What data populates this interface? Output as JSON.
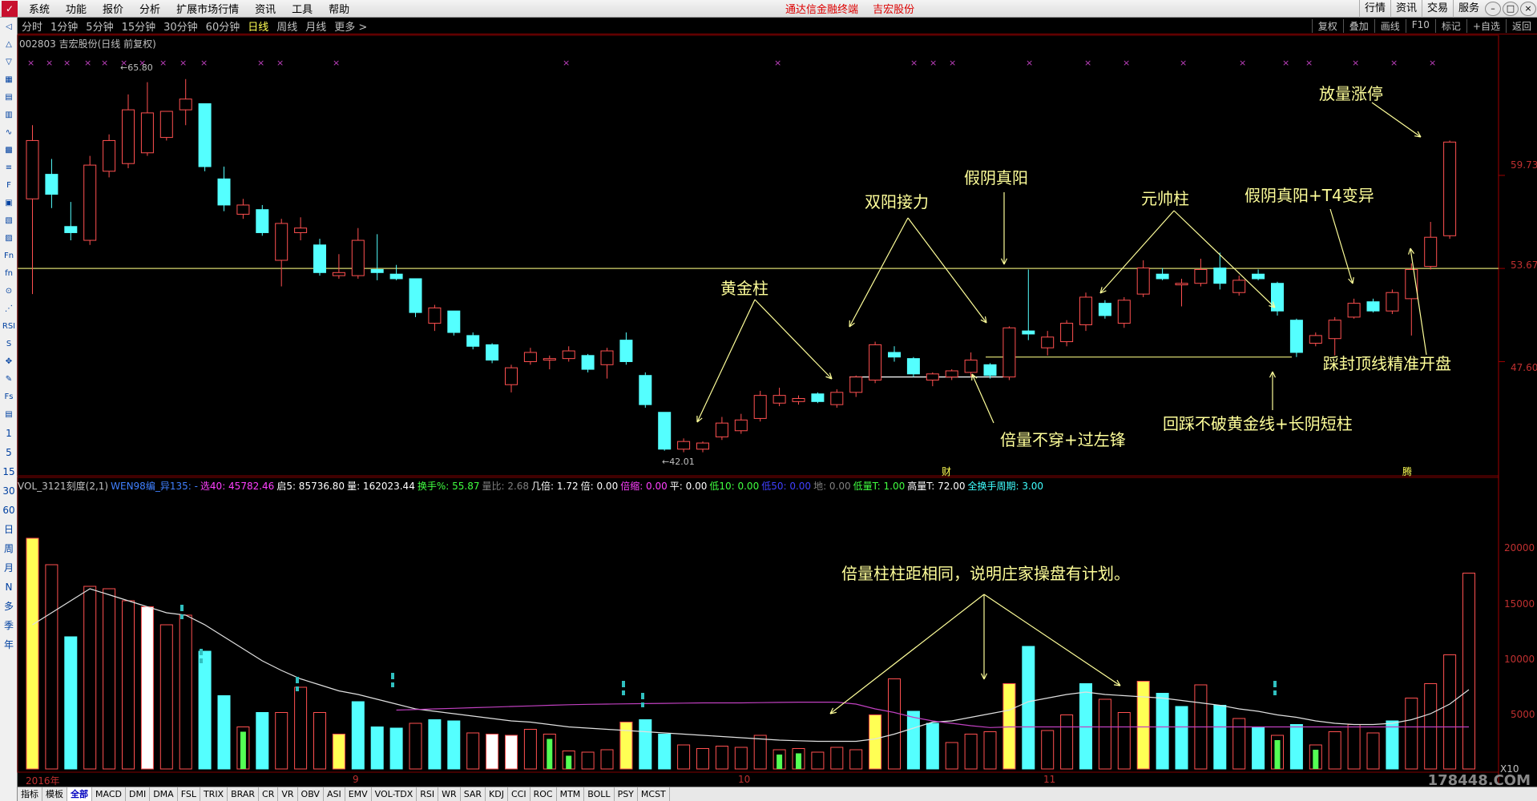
{
  "menubar": {
    "items": [
      "系统",
      "功能",
      "报价",
      "分析",
      "扩展市场行情",
      "资讯",
      "工具",
      "帮助"
    ],
    "center_title": [
      "通达信金融终端",
      "吉宏股份"
    ],
    "right_buttons": [
      "行情",
      "资讯",
      "交易",
      "服务"
    ]
  },
  "periodbar": {
    "items": [
      "分时",
      "1分钟",
      "5分钟",
      "15分钟",
      "30分钟",
      "60分钟",
      "日线",
      "周线",
      "月线",
      "更多 >"
    ],
    "active": "日线",
    "right_buttons": [
      "复权",
      "叠加",
      "画线",
      "F10",
      "标记",
      "+自选",
      "返回"
    ]
  },
  "stock": {
    "title": "002803 吉宏股份(日线 前复权)"
  },
  "toolstrip": {
    "tools": [
      "◁",
      "△",
      "▽",
      "▦",
      "▤",
      "▥",
      "∿",
      "▩",
      "≡",
      "F",
      "▣",
      "▧",
      "▨",
      "Fn",
      "fn",
      "⊙",
      "⋰",
      "RSI",
      "S",
      "✥",
      "✎",
      "Fs",
      "▤"
    ],
    "periods": [
      "1",
      "5",
      "15",
      "30",
      "60",
      "日",
      "周",
      "月",
      "N",
      "多",
      "季",
      "年"
    ]
  },
  "price_axis": {
    "labels": [
      "59.73",
      "53.67",
      "47.60"
    ]
  },
  "volume_axis": {
    "labels": [
      "20000",
      "15000",
      "10000",
      "5000"
    ],
    "unit": "X10"
  },
  "x_axis": {
    "labels": [
      "2016年",
      "9",
      "10",
      "11"
    ]
  },
  "markers": {
    "high_label": "65.80",
    "low_label": "42.01",
    "cai": "财",
    "teng": "腾"
  },
  "indicator_line": [
    {
      "text": "VOL_3121刻度(2,1)",
      "color": "#c0c0c0"
    },
    {
      "text": "WEN98编_异135: -",
      "color": "#4080ff"
    },
    {
      "text": "选40: 45782.46",
      "color": "#ff40ff"
    },
    {
      "text": "启5: 85736.80",
      "color": "#ffffff"
    },
    {
      "text": "量: 162023.44",
      "color": "#ffffff"
    },
    {
      "text": "换手%: 55.87",
      "color": "#40ff40"
    },
    {
      "text": "量比: 2.68",
      "color": "#808080"
    },
    {
      "text": "几倍: 1.72",
      "color": "#ffffff"
    },
    {
      "text": "倍: 0.00",
      "color": "#ffffff"
    },
    {
      "text": "倍缩: 0.00",
      "color": "#ff40ff"
    },
    {
      "text": "平: 0.00",
      "color": "#ffffff"
    },
    {
      "text": "低10: 0.00",
      "color": "#40ff40"
    },
    {
      "text": "低50: 0.00",
      "color": "#4040ff"
    },
    {
      "text": "地: 0.00",
      "color": "#808080"
    },
    {
      "text": "低量T: 1.00",
      "color": "#40ff40"
    },
    {
      "text": "高量T: 72.00",
      "color": "#ffffff"
    },
    {
      "text": "全换手周期: 3.00",
      "color": "#40ffff"
    }
  ],
  "annotations": {
    "golden_pillar": "黄金柱",
    "double_yang": "双阳接力",
    "fake_yin": "假阴真阳",
    "marshal": "元帅柱",
    "fake_yin_t4": "假阴真阳+T4变异",
    "volume_limit_up": "放量涨停",
    "step_top_line": "踩封顶线精准开盘",
    "double_volume": "倍量不穿+过左锋",
    "return_step": "回踩不破黄金线+长阴短柱",
    "volume_spacing": "倍量柱柱距相同，说明庄家操盘有计划。"
  },
  "tabbar": {
    "tabs": [
      "指标",
      "模板",
      "全部",
      "MACD",
      "DMI",
      "DMA",
      "FSL",
      "TRIX",
      "BRAR",
      "CR",
      "VR",
      "OBV",
      "ASI",
      "EMV",
      "VOL-TDX",
      "RSI",
      "WR",
      "SAR",
      "KDJ",
      "CCI",
      "ROC",
      "MTM",
      "BOLL",
      "PSY",
      "MCST"
    ],
    "active": "全部"
  },
  "watermark": "178448.COM",
  "chart_data": {
    "type": "candlestick",
    "price_range": [
      41.0,
      67.5
    ],
    "candles": [
      {
        "o": 58.2,
        "c": 62.0,
        "h": 63.0,
        "l": 52.0
      },
      {
        "o": 59.8,
        "c": 58.5,
        "h": 60.8,
        "l": 57.6
      },
      {
        "o": 56.4,
        "c": 56.0,
        "h": 58.0,
        "l": 55.5
      },
      {
        "o": 55.5,
        "c": 60.4,
        "h": 61.0,
        "l": 55.2
      },
      {
        "o": 60.0,
        "c": 62.0,
        "h": 62.4,
        "l": 59.6
      },
      {
        "o": 60.5,
        "c": 64.0,
        "h": 65.0,
        "l": 60.2
      },
      {
        "o": 61.2,
        "c": 63.8,
        "h": 65.8,
        "l": 61.0
      },
      {
        "o": 62.2,
        "c": 63.9,
        "h": 63.9,
        "l": 62.0
      },
      {
        "o": 64.0,
        "c": 64.7,
        "h": 66.0,
        "l": 63.0
      },
      {
        "o": 64.4,
        "c": 60.3,
        "h": 64.4,
        "l": 60.0
      },
      {
        "o": 59.5,
        "c": 57.8,
        "h": 60.3,
        "l": 57.4
      },
      {
        "o": 57.2,
        "c": 57.8,
        "h": 58.2,
        "l": 56.9
      },
      {
        "o": 57.5,
        "c": 56.0,
        "h": 57.8,
        "l": 55.8
      },
      {
        "o": 54.2,
        "c": 56.6,
        "h": 56.9,
        "l": 52.5
      },
      {
        "o": 56.0,
        "c": 56.3,
        "h": 57.0,
        "l": 55.5
      },
      {
        "o": 55.2,
        "c": 53.4,
        "h": 55.6,
        "l": 53.2
      },
      {
        "o": 53.2,
        "c": 53.4,
        "h": 54.6,
        "l": 53.0
      },
      {
        "o": 53.2,
        "c": 55.5,
        "h": 56.3,
        "l": 53.0
      },
      {
        "o": 53.6,
        "c": 53.4,
        "h": 55.9,
        "l": 52.9
      },
      {
        "o": 53.3,
        "c": 53.0,
        "h": 53.9,
        "l": 52.9
      },
      {
        "o": 53.0,
        "c": 50.8,
        "h": 53.0,
        "l": 50.5
      },
      {
        "o": 50.1,
        "c": 51.1,
        "h": 51.3,
        "l": 49.6
      },
      {
        "o": 50.9,
        "c": 49.5,
        "h": 50.9,
        "l": 49.3
      },
      {
        "o": 49.3,
        "c": 48.6,
        "h": 49.5,
        "l": 48.4
      },
      {
        "o": 48.7,
        "c": 47.7,
        "h": 48.8,
        "l": 47.5
      },
      {
        "o": 46.1,
        "c": 47.2,
        "h": 47.4,
        "l": 45.6
      },
      {
        "o": 47.6,
        "c": 48.2,
        "h": 48.5,
        "l": 47.4
      },
      {
        "o": 47.7,
        "c": 47.8,
        "h": 48.0,
        "l": 47.1
      },
      {
        "o": 47.8,
        "c": 48.3,
        "h": 48.6,
        "l": 47.6
      },
      {
        "o": 48.0,
        "c": 47.1,
        "h": 48.1,
        "l": 46.9
      },
      {
        "o": 47.4,
        "c": 48.3,
        "h": 48.5,
        "l": 46.5
      },
      {
        "o": 49.0,
        "c": 47.6,
        "h": 49.5,
        "l": 47.4
      },
      {
        "o": 46.7,
        "c": 44.8,
        "h": 46.9,
        "l": 44.6
      },
      {
        "o": 44.3,
        "c": 41.9,
        "h": 44.3,
        "l": 41.8
      },
      {
        "o": 41.9,
        "c": 42.4,
        "h": 42.6,
        "l": 41.7
      },
      {
        "o": 41.9,
        "c": 42.3,
        "h": 42.4,
        "l": 41.7
      },
      {
        "o": 42.7,
        "c": 43.6,
        "h": 44.0,
        "l": 42.5
      },
      {
        "o": 43.1,
        "c": 43.8,
        "h": 44.2,
        "l": 42.9
      },
      {
        "o": 43.9,
        "c": 45.4,
        "h": 45.7,
        "l": 43.7
      },
      {
        "o": 44.9,
        "c": 45.4,
        "h": 45.9,
        "l": 44.7
      },
      {
        "o": 45.0,
        "c": 45.2,
        "h": 45.4,
        "l": 44.8
      },
      {
        "o": 45.5,
        "c": 45.0,
        "h": 45.6,
        "l": 44.9
      },
      {
        "o": 44.8,
        "c": 45.6,
        "h": 45.8,
        "l": 44.6
      },
      {
        "o": 45.6,
        "c": 46.6,
        "h": 46.7,
        "l": 45.3
      },
      {
        "o": 46.4,
        "c": 48.7,
        "h": 48.9,
        "l": 46.2
      },
      {
        "o": 48.2,
        "c": 47.9,
        "h": 48.6,
        "l": 47.6
      },
      {
        "o": 47.8,
        "c": 46.8,
        "h": 47.9,
        "l": 46.6
      },
      {
        "o": 46.4,
        "c": 46.8,
        "h": 46.9,
        "l": 46.0
      },
      {
        "o": 46.6,
        "c": 47.0,
        "h": 47.1,
        "l": 46.4
      },
      {
        "o": 46.9,
        "c": 47.7,
        "h": 48.2,
        "l": 46.6
      },
      {
        "o": 47.4,
        "c": 46.7,
        "h": 47.5,
        "l": 46.5
      },
      {
        "o": 46.6,
        "c": 49.8,
        "h": 49.9,
        "l": 46.4
      },
      {
        "o": 49.6,
        "c": 49.4,
        "h": 53.6,
        "l": 49.0
      },
      {
        "o": 48.5,
        "c": 49.2,
        "h": 49.6,
        "l": 48.0
      },
      {
        "o": 48.9,
        "c": 50.1,
        "h": 50.3,
        "l": 48.6
      },
      {
        "o": 50.0,
        "c": 51.8,
        "h": 52.1,
        "l": 49.6
      },
      {
        "o": 51.4,
        "c": 50.6,
        "h": 51.6,
        "l": 50.4
      },
      {
        "o": 50.1,
        "c": 51.6,
        "h": 51.8,
        "l": 49.8
      },
      {
        "o": 52.0,
        "c": 53.7,
        "h": 54.2,
        "l": 51.8
      },
      {
        "o": 53.3,
        "c": 53.0,
        "h": 53.7,
        "l": 52.9
      },
      {
        "o": 52.6,
        "c": 52.7,
        "h": 53.0,
        "l": 51.2
      },
      {
        "o": 52.7,
        "c": 53.6,
        "h": 54.3,
        "l": 52.5
      },
      {
        "o": 53.7,
        "c": 52.7,
        "h": 54.7,
        "l": 52.3
      },
      {
        "o": 52.1,
        "c": 52.9,
        "h": 53.2,
        "l": 51.9
      },
      {
        "o": 53.3,
        "c": 53.0,
        "h": 53.6,
        "l": 52.9
      },
      {
        "o": 52.7,
        "c": 50.9,
        "h": 52.8,
        "l": 50.6
      },
      {
        "o": 50.3,
        "c": 48.2,
        "h": 50.4,
        "l": 47.9
      },
      {
        "o": 48.8,
        "c": 49.3,
        "h": 49.5,
        "l": 48.6
      },
      {
        "o": 49.1,
        "c": 50.3,
        "h": 50.5,
        "l": 48.0
      },
      {
        "o": 50.5,
        "c": 51.4,
        "h": 51.7,
        "l": 50.4
      },
      {
        "o": 51.5,
        "c": 50.9,
        "h": 51.7,
        "l": 50.8
      },
      {
        "o": 50.9,
        "c": 52.1,
        "h": 52.3,
        "l": 50.7
      },
      {
        "o": 51.7,
        "c": 53.6,
        "h": 54.0,
        "l": 49.3
      },
      {
        "o": 53.8,
        "c": 55.7,
        "h": 56.7,
        "l": 53.6
      },
      {
        "o": 55.8,
        "c": 61.9,
        "h": 62.0,
        "l": 55.6
      }
    ],
    "volume_range": [
      0,
      22000
    ],
    "volumes": [
      19200,
      17000,
      11000,
      15200,
      15000,
      14000,
      13500,
      12000,
      12800,
      9800,
      6100,
      3500,
      4700,
      4700,
      6800,
      4700,
      2900,
      5600,
      3500,
      3400,
      3800,
      4100,
      4000,
      3000,
      2900,
      2800,
      3300,
      2900,
      1500,
      1400,
      1600,
      3900,
      4100,
      2900,
      2000,
      1700,
      1900,
      1800,
      2800,
      1600,
      1700,
      1400,
      1800,
      1600,
      4500,
      7500,
      4800,
      3800,
      2200,
      2900,
      3100,
      7100,
      10200,
      3200,
      4500,
      7100,
      5800,
      4700,
      7300,
      6300,
      5200,
      7000,
      5300,
      4200,
      3500,
      2800,
      3700,
      2000,
      3100,
      3700,
      3000,
      4000,
      5900,
      7100,
      9500,
      16300
    ],
    "volume_colors": [
      "yellow",
      "red",
      "cyan",
      "red",
      "red",
      "red",
      "white",
      "red",
      "red",
      "cyan",
      "cyan",
      "green",
      "cyan",
      "red",
      "red",
      "red",
      "yellow",
      "cyan",
      "cyan",
      "cyan",
      "red",
      "cyan",
      "cyan",
      "red",
      "white",
      "white",
      "red",
      "green",
      "green",
      "red",
      "red",
      "yellow",
      "cyan",
      "cyan",
      "red",
      "red",
      "red",
      "red",
      "red",
      "green",
      "green",
      "red",
      "red",
      "red",
      "yellow",
      "red",
      "cyan",
      "cyan",
      "red",
      "red",
      "red",
      "yellow",
      "cyan",
      "red",
      "red",
      "cyan",
      "red",
      "red",
      "yellow",
      "cyan",
      "cyan",
      "red",
      "cyan",
      "red",
      "cyan",
      "green",
      "cyan",
      "green",
      "red",
      "red",
      "red",
      "cyan",
      "red",
      "red",
      "red",
      "red"
    ],
    "ma_volume": [
      12000,
      13000,
      14000,
      15000,
      14500,
      14000,
      13500,
      13000,
      12800,
      12000,
      11000,
      10000,
      9000,
      8200,
      7500,
      7000,
      6500,
      6200,
      5800,
      5400,
      5000,
      4800,
      4600,
      4400,
      4200,
      4000,
      3900,
      3700,
      3500,
      3400,
      3300,
      3200,
      3100,
      3000,
      2900,
      2800,
      2700,
      2600,
      2500,
      2400,
      2350,
      2300,
      2300,
      2300,
      2500,
      2900,
      3400,
      3900,
      4000,
      4300,
      4600,
      4900,
      5600,
      5900,
      6200,
      6400,
      6200,
      6100,
      6000,
      5900,
      5700,
      5500,
      5300,
      5000,
      4800,
      4500,
      4300,
      4000,
      3800,
      3700,
      3700,
      3800,
      4100,
      4600,
      5400,
      6600
    ],
    "ma_volume_purple": [
      null,
      null,
      null,
      null,
      null,
      null,
      null,
      null,
      null,
      null,
      null,
      null,
      null,
      null,
      null,
      null,
      null,
      null,
      null,
      4900,
      4950,
      5000,
      5050,
      5100,
      5150,
      5200,
      5250,
      5300,
      5350,
      5380,
      5400,
      5420,
      5440,
      5460,
      5480,
      5500,
      5500,
      5500,
      5520,
      5540,
      5560,
      5560,
      5560,
      5400,
      5000,
      4700,
      4300,
      4000,
      3800,
      3600,
      3450,
      3500,
      3500,
      3500,
      3500,
      3500,
      3500,
      3500,
      3500,
      3500,
      3500,
      3500,
      3500,
      3500,
      3500,
      3500,
      3500,
      3500,
      3500,
      3500,
      3500,
      3500,
      3500,
      3500,
      3500,
      3500
    ]
  }
}
